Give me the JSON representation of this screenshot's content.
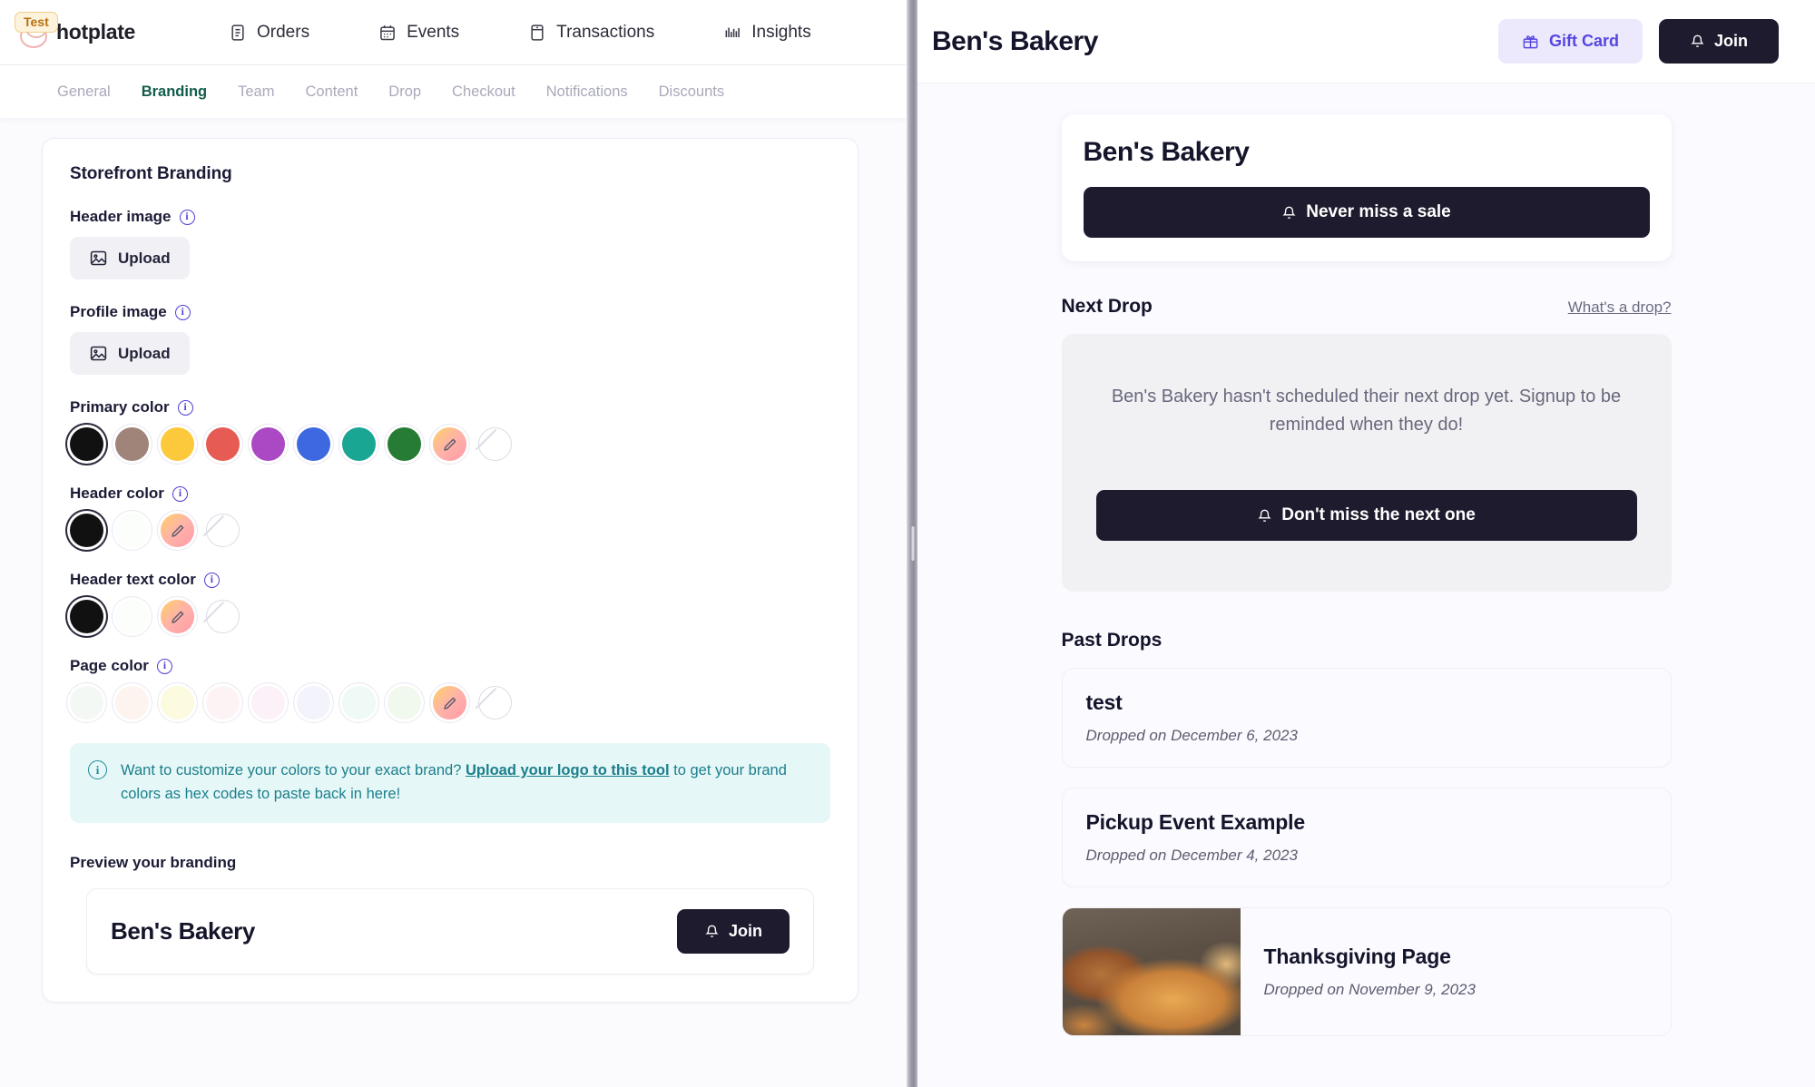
{
  "admin": {
    "brand": {
      "badge": "Test",
      "name": "hotplate",
      "logo_icon": "plate-logo"
    },
    "nav": [
      {
        "label": "Orders",
        "icon": "list-icon"
      },
      {
        "label": "Events",
        "icon": "calendar-icon"
      },
      {
        "label": "Transactions",
        "icon": "receipt-icon"
      },
      {
        "label": "Insights",
        "icon": "bar-chart-icon"
      }
    ],
    "subtabs": [
      {
        "label": "General",
        "active": false
      },
      {
        "label": "Branding",
        "active": true
      },
      {
        "label": "Team",
        "active": false
      },
      {
        "label": "Content",
        "active": false
      },
      {
        "label": "Drop",
        "active": false
      },
      {
        "label": "Checkout",
        "active": false
      },
      {
        "label": "Notifications",
        "active": false
      },
      {
        "label": "Discounts",
        "active": false
      }
    ],
    "card_title": "Storefront Branding",
    "header_image": {
      "label": "Header image",
      "upload_label": "Upload"
    },
    "profile_image": {
      "label": "Profile image",
      "upload_label": "Upload"
    },
    "primary_color": {
      "label": "Primary color",
      "swatches": [
        "#111111",
        "#a08379",
        "#fcc93c",
        "#e65c55",
        "#ab48c4",
        "#3d68e0",
        "#19a693",
        "#267c34",
        "custom",
        "none"
      ],
      "selected_index": 0
    },
    "header_color": {
      "label": "Header color",
      "swatches": [
        "#111111",
        "#fbfefb",
        "custom",
        "none"
      ],
      "selected_index": 0
    },
    "header_text_color": {
      "label": "Header text color",
      "swatches": [
        "#111111",
        "#fbfefb",
        "custom",
        "none"
      ],
      "selected_index": 0
    },
    "page_color": {
      "label": "Page color",
      "swatches": [
        "#f4f8f4",
        "#fdf4ef",
        "#fcfadf",
        "#fdf3f4",
        "#fcf1f8",
        "#f3f4fb",
        "#eff9f6",
        "#f1f8ee",
        "custom",
        "none"
      ],
      "selected_index": -1
    },
    "tip": {
      "text_before": "Want to customize your colors to your exact brand? ",
      "link": "Upload your logo to this tool",
      "text_after": " to get your brand colors as hex codes to paste back in here!",
      "icon": "info-icon",
      "accent": "#1b7f8c"
    },
    "preview": {
      "label": "Preview your branding",
      "store_name": "Ben's Bakery",
      "join_label": "Join",
      "join_icon": "bell-icon"
    }
  },
  "storefront": {
    "header": {
      "title": "Ben's Bakery",
      "gift_card_label": "Gift Card",
      "gift_card_icon": "gift-icon",
      "join_label": "Join",
      "join_icon": "bell-icon",
      "gift_card_bg": "#ece9fd",
      "gift_card_fg": "#5546e0"
    },
    "hero": {
      "name": "Ben's Bakery",
      "cta_label": "Never miss a sale",
      "cta_icon": "bell-icon"
    },
    "next_drop": {
      "title": "Next Drop",
      "help_link": "What's a drop?",
      "empty_message": "Ben's Bakery hasn't scheduled their next drop yet. Signup to be reminded when they do!",
      "cta_label": "Don't miss the next one",
      "cta_icon": "bell-icon"
    },
    "past_drops": {
      "title": "Past Drops",
      "items": [
        {
          "title": "test",
          "date": "Dropped on December 6, 2023",
          "has_image": false
        },
        {
          "title": "Pickup Event Example",
          "date": "Dropped on December 4, 2023",
          "has_image": false
        },
        {
          "title": "Thanksgiving Page",
          "date": "Dropped on November 9, 2023",
          "has_image": true,
          "image_alt": "bread-loaves-photo"
        }
      ]
    }
  }
}
